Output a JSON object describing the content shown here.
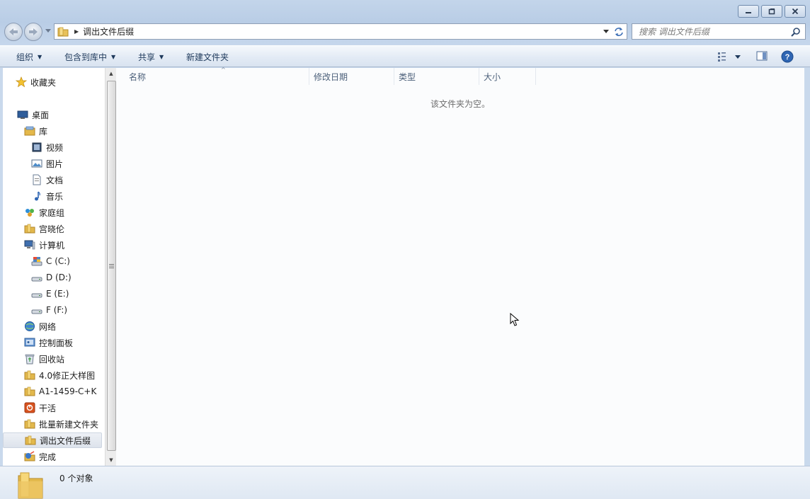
{
  "window": {
    "minimize_label": "minimize",
    "maximize_label": "maximize",
    "close_label": "close"
  },
  "address": {
    "path": "调出文件后缀",
    "search_placeholder": "搜索 调出文件后缀"
  },
  "toolbar": {
    "organize": "组织",
    "include_in_library": "包含到库中",
    "share": "共享",
    "new_folder": "新建文件夹"
  },
  "sidebar": {
    "items": [
      {
        "label": "收藏夹",
        "icon": "star-icon"
      },
      {
        "label": "桌面",
        "icon": "desktop-icon"
      },
      {
        "label": "库",
        "icon": "library-icon"
      },
      {
        "label": "视频",
        "icon": "video-icon"
      },
      {
        "label": "图片",
        "icon": "picture-icon"
      },
      {
        "label": "文档",
        "icon": "document-icon"
      },
      {
        "label": "音乐",
        "icon": "music-icon"
      },
      {
        "label": "家庭组",
        "icon": "homegroup-icon"
      },
      {
        "label": "宫晓伦",
        "icon": "user-folder-icon"
      },
      {
        "label": "计算机",
        "icon": "computer-icon"
      },
      {
        "label": "C (C:)",
        "icon": "system-drive-icon"
      },
      {
        "label": "D (D:)",
        "icon": "drive-icon"
      },
      {
        "label": "E (E:)",
        "icon": "drive-icon"
      },
      {
        "label": "F (F:)",
        "icon": "drive-icon"
      },
      {
        "label": "网络",
        "icon": "network-icon"
      },
      {
        "label": "控制面板",
        "icon": "control-panel-icon"
      },
      {
        "label": "回收站",
        "icon": "recycle-bin-icon"
      },
      {
        "label": "4.0修正大样图",
        "icon": "folder-icon"
      },
      {
        "label": "A1-1459-C+K",
        "icon": "folder-icon"
      },
      {
        "label": "干活",
        "icon": "app-icon"
      },
      {
        "label": "批量新建文件夹",
        "icon": "folder-icon"
      },
      {
        "label": "调出文件后缀",
        "icon": "folder-icon",
        "selected": true
      },
      {
        "label": "完成",
        "icon": "shortcut-icon"
      }
    ]
  },
  "columns": [
    "名称",
    "修改日期",
    "类型",
    "大小"
  ],
  "main": {
    "empty_message": "该文件夹为空。"
  },
  "details": {
    "count": "0 个对象"
  }
}
